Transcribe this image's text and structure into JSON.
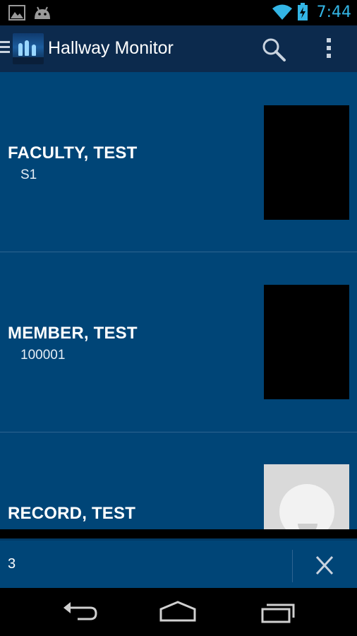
{
  "status_bar": {
    "time": "7:44",
    "left_icons": [
      "image-icon",
      "android-icon"
    ],
    "right_icons": [
      "wifi-icon",
      "battery-charging-icon"
    ],
    "accent_color": "#33b5e5"
  },
  "action_bar": {
    "title": "Hallway Monitor",
    "icons": [
      "drawer-menu-icon",
      "app-logo",
      "search-icon",
      "overflow-menu-icon"
    ],
    "background": "#0c2a4d"
  },
  "list": {
    "background": "#004577",
    "items": [
      {
        "name": "FACULTY, TEST",
        "id": "S1",
        "photo": "black"
      },
      {
        "name": "MEMBER, TEST",
        "id": "100001",
        "photo": "black"
      },
      {
        "name": "RECORD, TEST",
        "id": "",
        "photo": "placeholder-avatar"
      }
    ]
  },
  "search": {
    "value": "3",
    "clear_icon": "close-icon"
  },
  "nav_bar": {
    "buttons": [
      "back-icon",
      "home-icon",
      "recent-apps-icon"
    ]
  }
}
